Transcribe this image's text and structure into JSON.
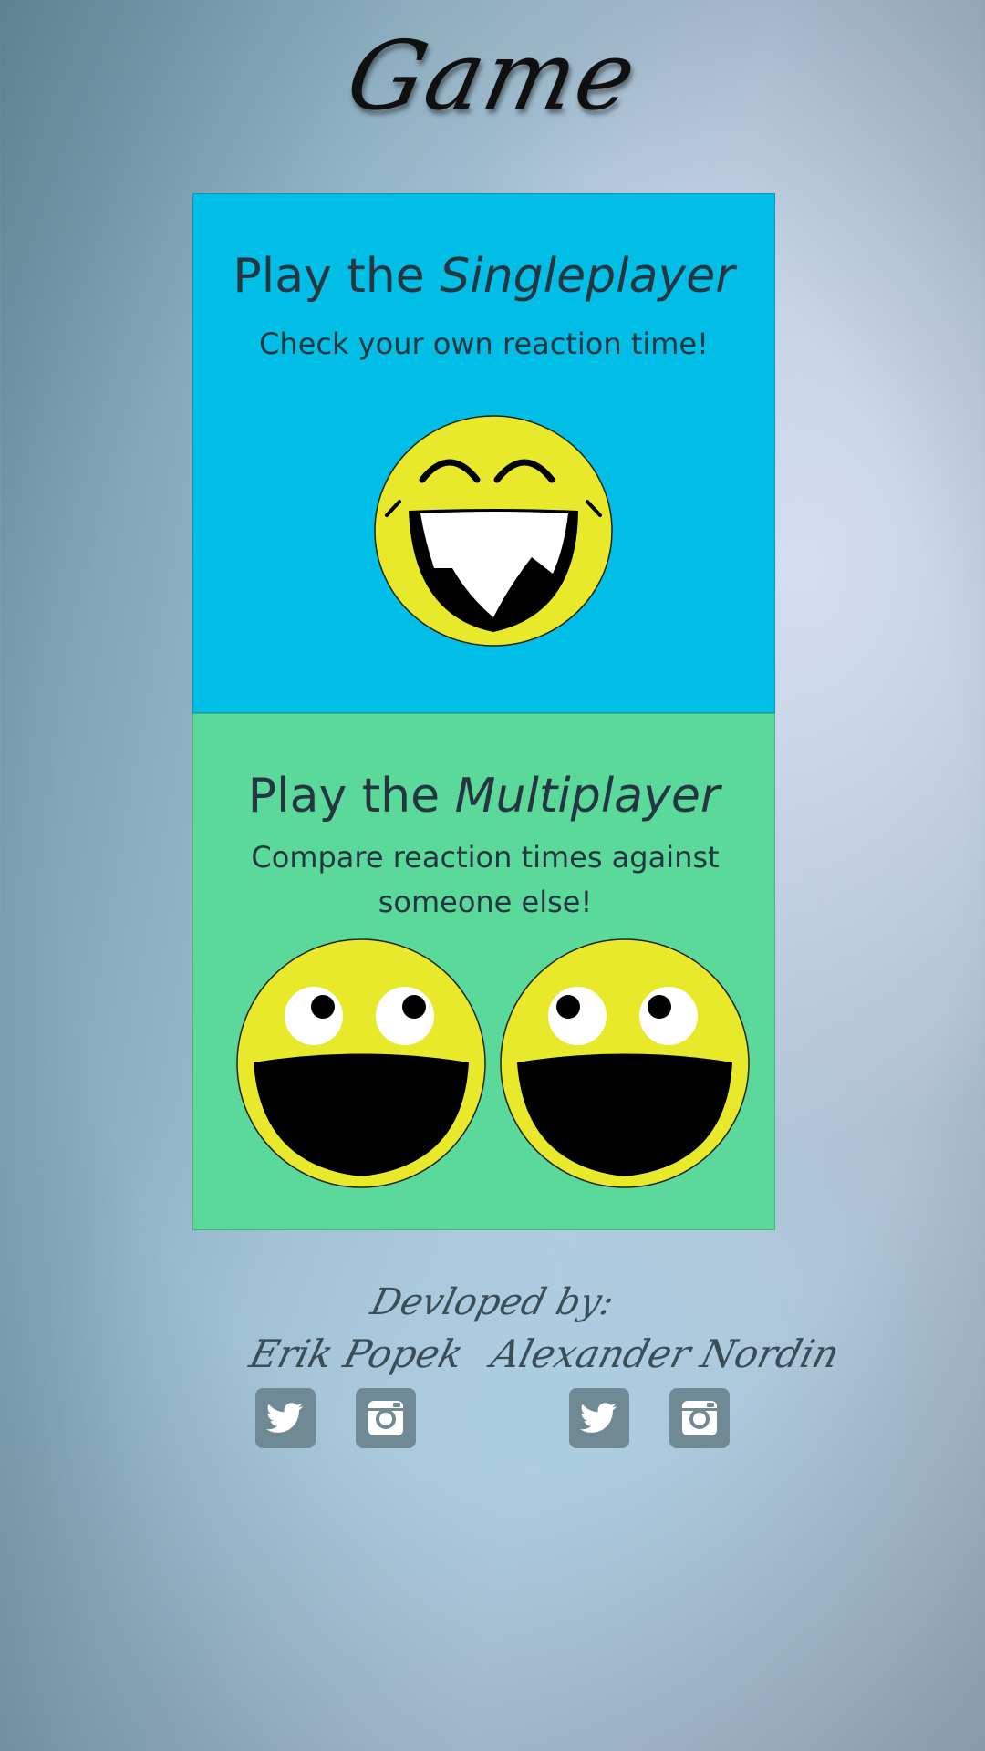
{
  "app_title": "Game",
  "singleplayer": {
    "heading_prefix": "Play the ",
    "heading_mode": "Singleplayer",
    "subtitle": "Check your own reaction time!",
    "background_color": "#00bee5",
    "icon": "laughing-smiley-icon"
  },
  "multiplayer": {
    "heading_prefix": "Play the ",
    "heading_mode": "Multiplayer",
    "subtitle": "Compare reaction times against someone else!",
    "background_color": "#5bd99a",
    "icons": [
      "happy-smiley-icon",
      "happy-smiley-icon"
    ]
  },
  "credits": {
    "label": "Devloped by:",
    "developers": [
      {
        "name": "Erik Popek",
        "links": [
          "twitter-icon",
          "instagram-icon"
        ]
      },
      {
        "name": "Alexander Nordin",
        "links": [
          "twitter-icon",
          "instagram-icon"
        ]
      }
    ]
  },
  "colors": {
    "smiley_yellow": "#e8e92b",
    "text_dark": "#263640",
    "social_button": "#6f8a94"
  }
}
